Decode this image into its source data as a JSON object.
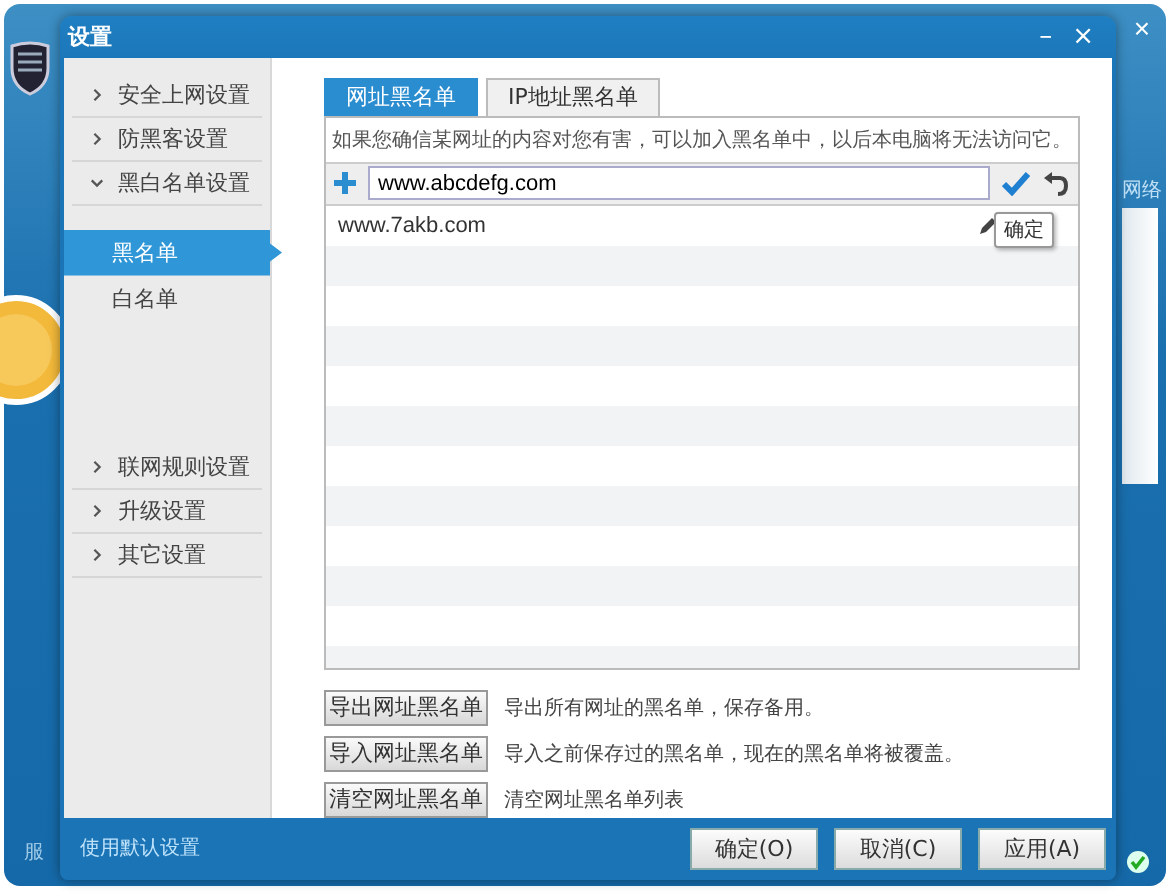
{
  "background_window": {
    "close": "×",
    "side_label": "网络",
    "footer_label": "服"
  },
  "dialog": {
    "title": "设置",
    "minimize": "–",
    "close": "×"
  },
  "sidebar": {
    "items": [
      {
        "label": "安全上网设置",
        "expanded": false
      },
      {
        "label": "防黑客设置",
        "expanded": false
      },
      {
        "label": "黑白名单设置",
        "expanded": true,
        "children": [
          {
            "label": "黑名单",
            "selected": true
          },
          {
            "label": "白名单",
            "selected": false
          }
        ]
      },
      {
        "label": "联网规则设置",
        "expanded": false
      },
      {
        "label": "升级设置",
        "expanded": false
      },
      {
        "label": "其它设置",
        "expanded": false
      }
    ]
  },
  "tabs": [
    {
      "label": "网址黑名单",
      "selected": true
    },
    {
      "label": "IP地址黑名单",
      "selected": false
    }
  ],
  "hint": "如果您确信某网址的内容对您有害，可以加入黑名单中，以后本电脑将无法访问它。",
  "entry": {
    "value": "www.abcdefg.com"
  },
  "list": {
    "rows": [
      {
        "url": "www.7akb.com",
        "tooltip": "确定"
      }
    ]
  },
  "actions": [
    {
      "button": "导出网址黑名单",
      "description": "导出所有网址的黑名单，保存备用。"
    },
    {
      "button": "导入网址黑名单",
      "description": "导入之前保存过的黑名单，现在的黑名单将被覆盖。"
    },
    {
      "button": "清空网址黑名单",
      "description": "清空网址黑名单列表"
    }
  ],
  "footer": {
    "link": "使用默认设置",
    "buttons": [
      "确定(O)",
      "取消(C)",
      "应用(A)"
    ]
  }
}
